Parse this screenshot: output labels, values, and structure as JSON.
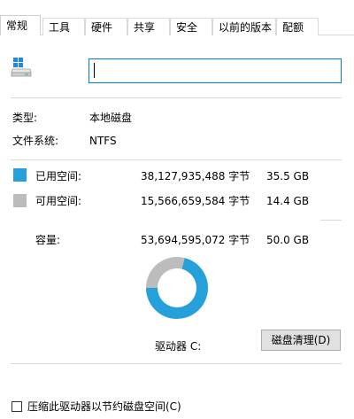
{
  "tabs": [
    {
      "label": "常规",
      "active": true
    },
    {
      "label": "工具"
    },
    {
      "label": "硬件"
    },
    {
      "label": "共享"
    },
    {
      "label": "安全"
    },
    {
      "label": "以前的版本"
    },
    {
      "label": "配额"
    }
  ],
  "drive": {
    "icon": "drive-icon",
    "name_value": ""
  },
  "info": {
    "type_label": "类型:",
    "type_value": "本地磁盘",
    "fs_label": "文件系统:",
    "fs_value": "NTFS"
  },
  "space": {
    "used": {
      "label": "已用空间:",
      "bytes": "38,127,935,488 字节",
      "size": "35.5 GB",
      "color": "#26a0da"
    },
    "free": {
      "label": "可用空间:",
      "bytes": "15,566,659,584 字节",
      "size": "14.4 GB",
      "color": "#bcbcbc"
    },
    "capacity": {
      "label": "容量:",
      "bytes": "53,694,595,072 字节",
      "size": "50.0 GB"
    }
  },
  "chart_data": {
    "type": "pie",
    "categories": [
      "已用空间",
      "可用空间"
    ],
    "values": [
      38127935488,
      15566659584
    ],
    "colors": [
      "#26a0da",
      "#bcbcbc"
    ]
  },
  "drive_label": "驱动器 C:",
  "cleanup_button": "磁盘清理(D)",
  "compress_checkbox": {
    "label": "压缩此驱动器以节约磁盘空间(C)",
    "checked": false
  }
}
